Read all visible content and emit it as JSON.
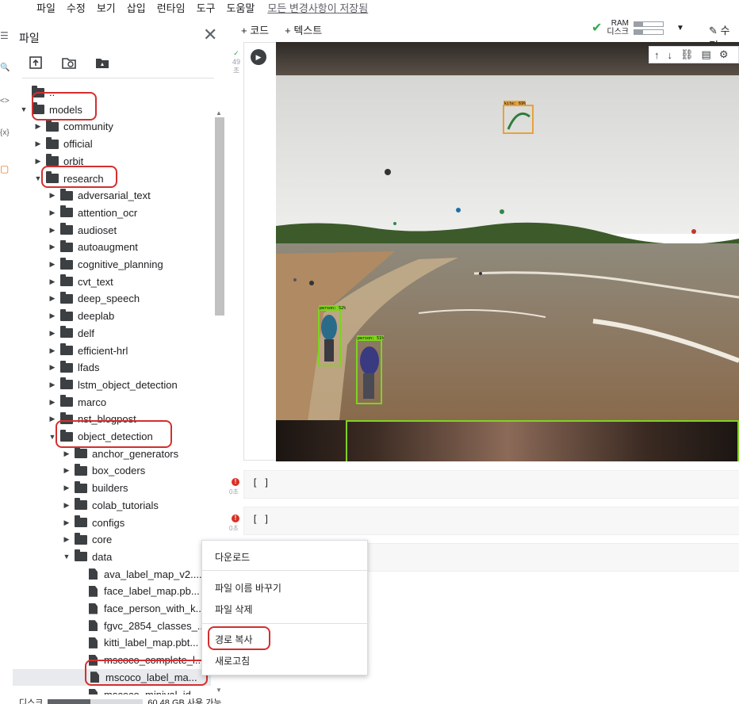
{
  "menubar": {
    "items": [
      "파일",
      "수정",
      "보기",
      "삽입",
      "런타임",
      "도구",
      "도움말"
    ],
    "status": "모든 변경사항이 저장됨"
  },
  "rail": {
    "icons": [
      "menu-icon",
      "search-icon",
      "code-icon",
      "variables-icon",
      "files-icon"
    ],
    "glyphs": [
      "☰",
      "🔍",
      "<>",
      "{x}",
      "▢"
    ]
  },
  "panel": {
    "title": "파일",
    "close": "✕",
    "disk_label": "디스크",
    "disk_free": "60.48 GB 사용 가능",
    "disk_used_fraction": 0.45
  },
  "tree": [
    {
      "label": "..",
      "depth": 0,
      "type": "folder",
      "arrow": ""
    },
    {
      "label": "models",
      "depth": 0,
      "type": "folder",
      "arrow": "▼"
    },
    {
      "label": "community",
      "depth": 1,
      "type": "folder",
      "arrow": "▶"
    },
    {
      "label": "official",
      "depth": 1,
      "type": "folder",
      "arrow": "▶"
    },
    {
      "label": "orbit",
      "depth": 1,
      "type": "folder",
      "arrow": "▶"
    },
    {
      "label": "research",
      "depth": 1,
      "type": "folder",
      "arrow": "▼"
    },
    {
      "label": "adversarial_text",
      "depth": 2,
      "type": "folder",
      "arrow": "▶"
    },
    {
      "label": "attention_ocr",
      "depth": 2,
      "type": "folder",
      "arrow": "▶"
    },
    {
      "label": "audioset",
      "depth": 2,
      "type": "folder",
      "arrow": "▶"
    },
    {
      "label": "autoaugment",
      "depth": 2,
      "type": "folder",
      "arrow": "▶"
    },
    {
      "label": "cognitive_planning",
      "depth": 2,
      "type": "folder",
      "arrow": "▶"
    },
    {
      "label": "cvt_text",
      "depth": 2,
      "type": "folder",
      "arrow": "▶"
    },
    {
      "label": "deep_speech",
      "depth": 2,
      "type": "folder",
      "arrow": "▶"
    },
    {
      "label": "deeplab",
      "depth": 2,
      "type": "folder",
      "arrow": "▶"
    },
    {
      "label": "delf",
      "depth": 2,
      "type": "folder",
      "arrow": "▶"
    },
    {
      "label": "efficient-hrl",
      "depth": 2,
      "type": "folder",
      "arrow": "▶"
    },
    {
      "label": "lfads",
      "depth": 2,
      "type": "folder",
      "arrow": "▶"
    },
    {
      "label": "lstm_object_detection",
      "depth": 2,
      "type": "folder",
      "arrow": "▶"
    },
    {
      "label": "marco",
      "depth": 2,
      "type": "folder",
      "arrow": "▶"
    },
    {
      "label": "nst_blogpost",
      "depth": 2,
      "type": "folder",
      "arrow": "▶"
    },
    {
      "label": "object_detection",
      "depth": 2,
      "type": "folder",
      "arrow": "▼"
    },
    {
      "label": "anchor_generators",
      "depth": 3,
      "type": "folder",
      "arrow": "▶"
    },
    {
      "label": "box_coders",
      "depth": 3,
      "type": "folder",
      "arrow": "▶"
    },
    {
      "label": "builders",
      "depth": 3,
      "type": "folder",
      "arrow": "▶"
    },
    {
      "label": "colab_tutorials",
      "depth": 3,
      "type": "folder",
      "arrow": "▶"
    },
    {
      "label": "configs",
      "depth": 3,
      "type": "folder",
      "arrow": "▶"
    },
    {
      "label": "core",
      "depth": 3,
      "type": "folder",
      "arrow": "▶"
    },
    {
      "label": "data",
      "depth": 3,
      "type": "folder",
      "arrow": "▼"
    },
    {
      "label": "ava_label_map_v2....",
      "depth": 4,
      "type": "file",
      "arrow": ""
    },
    {
      "label": "face_label_map.pb...",
      "depth": 4,
      "type": "file",
      "arrow": ""
    },
    {
      "label": "face_person_with_k...",
      "depth": 4,
      "type": "file",
      "arrow": ""
    },
    {
      "label": "fgvc_2854_classes_...",
      "depth": 4,
      "type": "file",
      "arrow": ""
    },
    {
      "label": "kitti_label_map.pbt...",
      "depth": 4,
      "type": "file",
      "arrow": ""
    },
    {
      "label": "mscoco_complete_l...",
      "depth": 4,
      "type": "file",
      "arrow": ""
    },
    {
      "label": "mscoco_label_ma...",
      "depth": 4,
      "type": "file",
      "arrow": "",
      "selected": true
    },
    {
      "label": "mscoco_minival_id...",
      "depth": 4,
      "type": "file",
      "arrow": ""
    }
  ],
  "notebook": {
    "add_code": "+ 코드",
    "add_text": "+ 텍스트",
    "ram_label": "RAM",
    "disk_label": "디스크",
    "edit_label": "수정",
    "exec_count": "49",
    "exec_unit": "초",
    "empty_cell_text": "[ ]",
    "err_time": "0초",
    "detections": [
      {
        "label": "kite: 69%",
        "color": "#e6a23c"
      },
      {
        "label": "person: 52%",
        "color": "#7ed321"
      },
      {
        "label": "person: 51%",
        "color": "#7ed321"
      }
    ]
  },
  "context_menu": {
    "items": [
      "다운로드",
      "파일 이름 바꾸기",
      "파일 삭제",
      "경로 복사",
      "새로고침"
    ]
  }
}
